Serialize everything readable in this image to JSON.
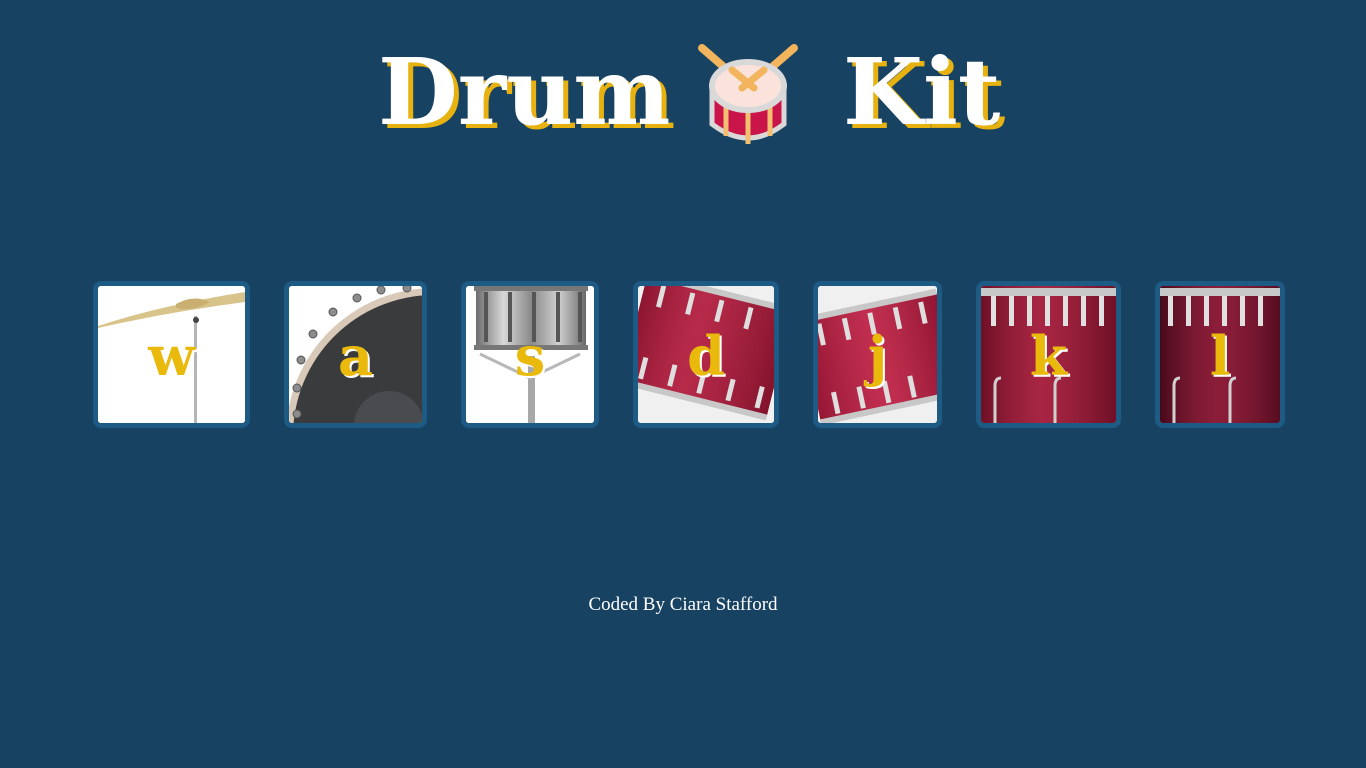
{
  "header": {
    "title_left": "Drum",
    "title_right": "Kit",
    "emoji_icon": "drum-with-drumsticks-icon"
  },
  "drums": [
    {
      "key": "w",
      "instrument_icon": "crash-cymbal-icon"
    },
    {
      "key": "a",
      "instrument_icon": "bass-drum-icon"
    },
    {
      "key": "s",
      "instrument_icon": "snare-drum-icon"
    },
    {
      "key": "d",
      "instrument_icon": "tom-1-icon"
    },
    {
      "key": "j",
      "instrument_icon": "tom-2-icon"
    },
    {
      "key": "k",
      "instrument_icon": "tom-3-icon"
    },
    {
      "key": "l",
      "instrument_icon": "tom-4-icon"
    }
  ],
  "footer": {
    "credit": "Coded By Ciara Stafford"
  },
  "colors": {
    "background": "#174262",
    "key_border": "#1d5a84",
    "letter": "#e9b90c",
    "title_shadow": "#e7b20f",
    "drum_red": "#a61c3c"
  }
}
